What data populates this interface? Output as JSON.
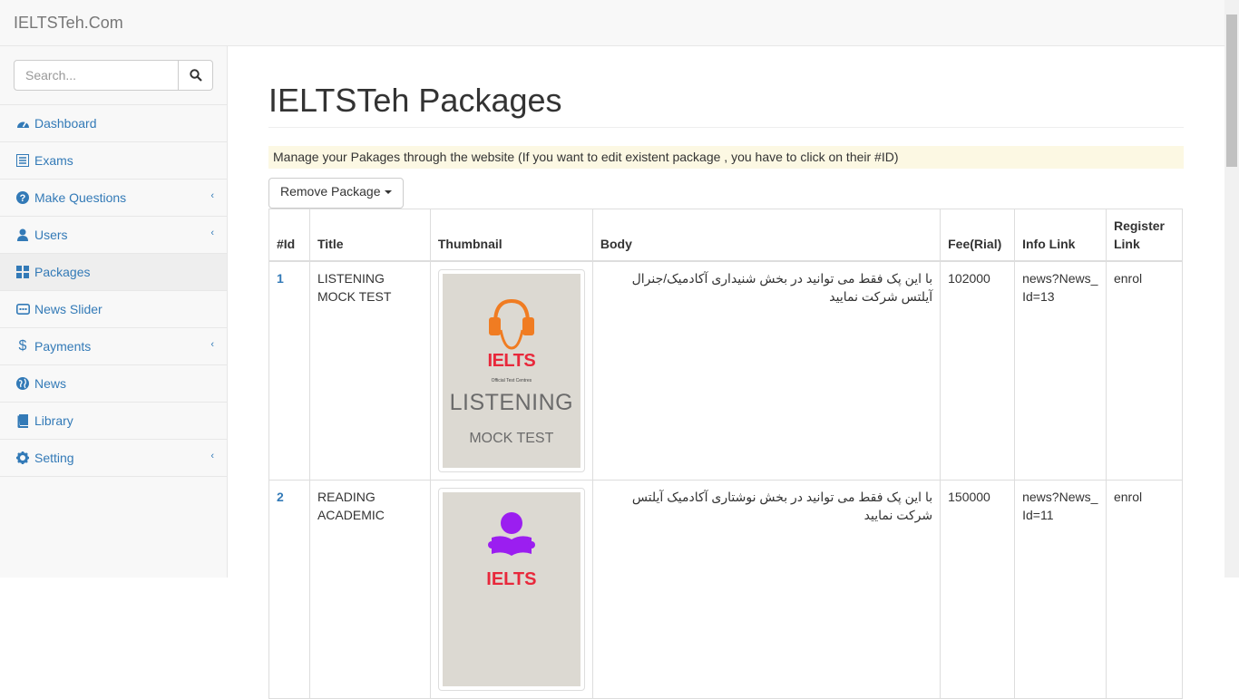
{
  "brand": "IELTSTeh.Com",
  "search": {
    "placeholder": "Search..."
  },
  "sidebar": {
    "items": [
      {
        "label": "Dashboard",
        "icon": "dashboard-icon"
      },
      {
        "label": "Exams",
        "icon": "list-icon"
      },
      {
        "label": "Make Questions",
        "icon": "question-icon",
        "arrow": true
      },
      {
        "label": "Users",
        "icon": "user-icon",
        "arrow": true
      },
      {
        "label": "Packages",
        "icon": "grid-icon"
      },
      {
        "label": "News Slider",
        "icon": "slider-icon"
      },
      {
        "label": "Payments",
        "icon": "dollar-icon",
        "arrow": true
      },
      {
        "label": "News",
        "icon": "globe-icon"
      },
      {
        "label": "Library",
        "icon": "book-icon"
      },
      {
        "label": "Setting",
        "icon": "gear-icon",
        "arrow": true
      }
    ]
  },
  "main": {
    "title": "IELTSTeh Packages",
    "notice": "Manage your Pakages through the website (If you want to edit existent package , you have to click on their #ID)",
    "remove_button": "Remove Package",
    "table": {
      "headers": [
        "#Id",
        "Title",
        "Thumbnail",
        "Body",
        "Fee(Rial)",
        "Info Link",
        "Register Link"
      ],
      "rows": [
        {
          "id": "1",
          "title": "LISTENING MOCK TEST",
          "thumb_brand": "IELTS",
          "thumb_sub": "Official Test Centres",
          "thumb_line1": "LISTENING",
          "thumb_line2": "MOCK TEST",
          "body": "با این پک فقط می توانید در بخش شنیداری آکادمیک/جنرال آیلتس شرکت نمایید",
          "fee": "102000",
          "info": "news?News_Id=13",
          "register": "enrol"
        },
        {
          "id": "2",
          "title": "READING ACADEMIC",
          "thumb_brand": "IELTS",
          "body": "با این پک فقط می توانید در بخش نوشتاری  آکادمیک آیلتس شرکت نمایید",
          "fee": "150000",
          "info": "news?News_Id=11",
          "register": "enrol"
        }
      ]
    }
  },
  "colors": {
    "link": "#337ab7",
    "notice_bg": "#fcf8e3",
    "sidebar_bg": "#f8f8f8"
  }
}
